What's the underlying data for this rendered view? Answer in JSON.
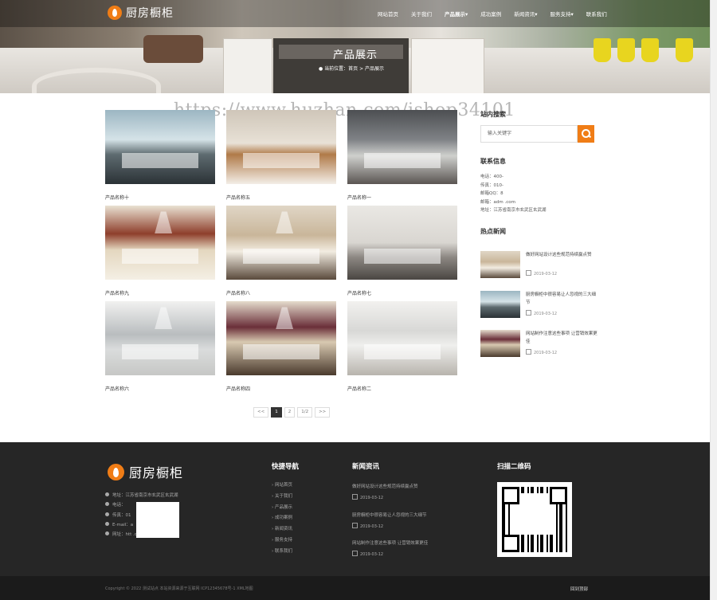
{
  "header": {
    "logo_text": "厨房橱柜",
    "nav": [
      {
        "label": "网站首页",
        "active": false
      },
      {
        "label": "关于我们",
        "active": false
      },
      {
        "label": "产品展示▾",
        "active": true
      },
      {
        "label": "成功案例",
        "active": false
      },
      {
        "label": "新闻资讯▾",
        "active": false
      },
      {
        "label": "服务支持▾",
        "active": false
      },
      {
        "label": "联系我们",
        "active": false
      }
    ],
    "banner_title": "产品展示",
    "breadcrumb": "当前位置：首页 > 产品展示"
  },
  "watermark": "https://www.huzhan.com/ishop34101",
  "products": [
    {
      "name": "产品名称十"
    },
    {
      "name": "产品名称五"
    },
    {
      "name": "产品名称一"
    },
    {
      "name": "产品名称九"
    },
    {
      "name": "产品名称八"
    },
    {
      "name": "产品名称七"
    },
    {
      "name": "产品名称六"
    },
    {
      "name": "产品名称四"
    },
    {
      "name": "产品名称二"
    }
  ],
  "pagination": {
    "prev": "<<",
    "pages": [
      "1",
      "2"
    ],
    "total": "1/2",
    "next": ">>"
  },
  "sidebar": {
    "search_title": "站内搜索",
    "search_placeholder": "输入关键字",
    "contact_title": "联系信息",
    "contact_lines": [
      "电话：400-",
      "传真：010-",
      "邮箱QQ：8",
      "邮箱：adm              .com",
      "地址：江苏省南京市玄武区玄武湖"
    ],
    "hot_news_title": "热点新闻",
    "hot_news": [
      {
        "title": "做好网站设计这些规范持续赢点赞",
        "date": "2019-03-12"
      },
      {
        "title": "厨房橱柜中很容易让人忽视的三大细节",
        "date": "2019-03-12"
      },
      {
        "title": "网站制作注意这些事项 让营销效果更佳",
        "date": "2019-03-12"
      }
    ]
  },
  "footer": {
    "logo_text": "厨房橱柜",
    "info": [
      "地址：江苏省南京市玄武区玄武湖",
      "电话：",
      "传真：01",
      "E-mail：a",
      "网址：htt                        .com"
    ],
    "quick_nav_title": "快捷导航",
    "quick_nav": [
      "网站首页",
      "关于我们",
      "产品展示",
      "成功案例",
      "新闻资讯",
      "服务支持",
      "联系我们"
    ],
    "news_title": "新闻资讯",
    "news": [
      {
        "title": "做好网站设计这些规范持续赢点赞",
        "date": "2019-03-12"
      },
      {
        "title": "厨房橱柜中很容易让人忽视的三大细节",
        "date": "2019-03-12"
      },
      {
        "title": "网站制作注意这些事项 让营销效果更佳",
        "date": "2019-03-12"
      }
    ],
    "qr_title": "扫描二维码",
    "copyright": "Copyright © 2022 测试站点 本站资源来源于互联网    ICP12345678号-1    XML地图",
    "back_to_top": "回到顶部"
  },
  "colors": {
    "accent": "#f07d16",
    "footer_bg": "#262626",
    "footer_bottom": "#1b1b1b"
  }
}
